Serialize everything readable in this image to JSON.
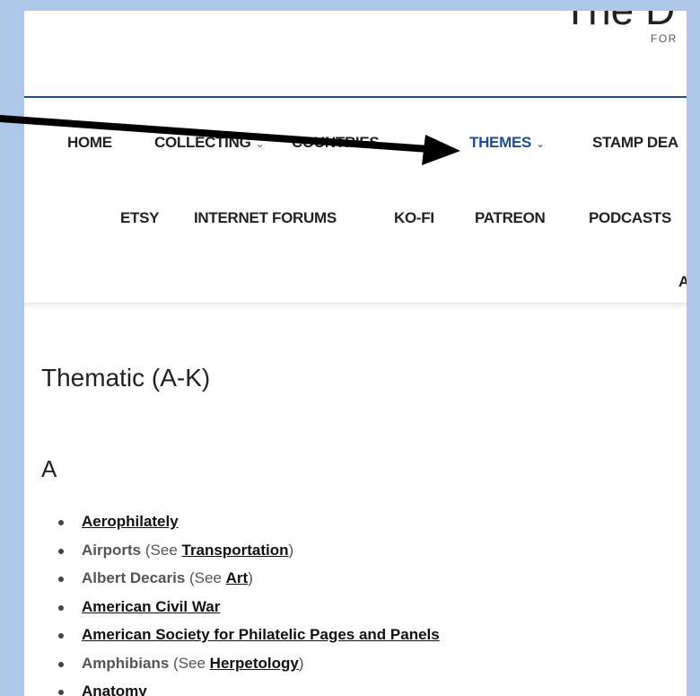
{
  "header": {
    "site_title": "The D",
    "tagline": "FOR"
  },
  "nav": {
    "row1": [
      {
        "label": "HOME",
        "dropdown": false
      },
      {
        "label": "COLLECTING",
        "dropdown": true
      },
      {
        "label": "COUNTRIES",
        "dropdown": true
      },
      {
        "label": "THEMES",
        "dropdown": true,
        "active": true
      },
      {
        "label": "STAMP DEA",
        "dropdown": false
      }
    ],
    "row2": [
      {
        "label": "ETSY"
      },
      {
        "label": "INTERNET FORUMS"
      },
      {
        "label": "KO-FI"
      },
      {
        "label": "PATREON"
      },
      {
        "label": "PODCASTS"
      }
    ],
    "row3": [
      {
        "label": "A"
      }
    ],
    "chevron_glyph": "⌄"
  },
  "main": {
    "page_title": "Thematic (A-K)",
    "section_letter": "A",
    "items": [
      {
        "link": "Aerophilately"
      },
      {
        "text": "Airports",
        "see_prefix": "(See ",
        "link": "Transportation",
        "see_suffix": ")"
      },
      {
        "text": "Albert Decaris",
        "see_prefix": "(See ",
        "link": "Art",
        "see_suffix": ")"
      },
      {
        "link": "American Civil War"
      },
      {
        "link": "American Society for Philatelic Pages and Panels"
      },
      {
        "text": "Amphibians",
        "see_prefix": "(See ",
        "link": "Herpetology",
        "see_suffix": ")"
      },
      {
        "link": "Anatomy"
      }
    ]
  },
  "colors": {
    "background": "#aec6e8",
    "accent": "#1e4f8c",
    "annotation_arrow": "#000000"
  },
  "annotation": {
    "type": "arrow",
    "target": "THEMES"
  }
}
